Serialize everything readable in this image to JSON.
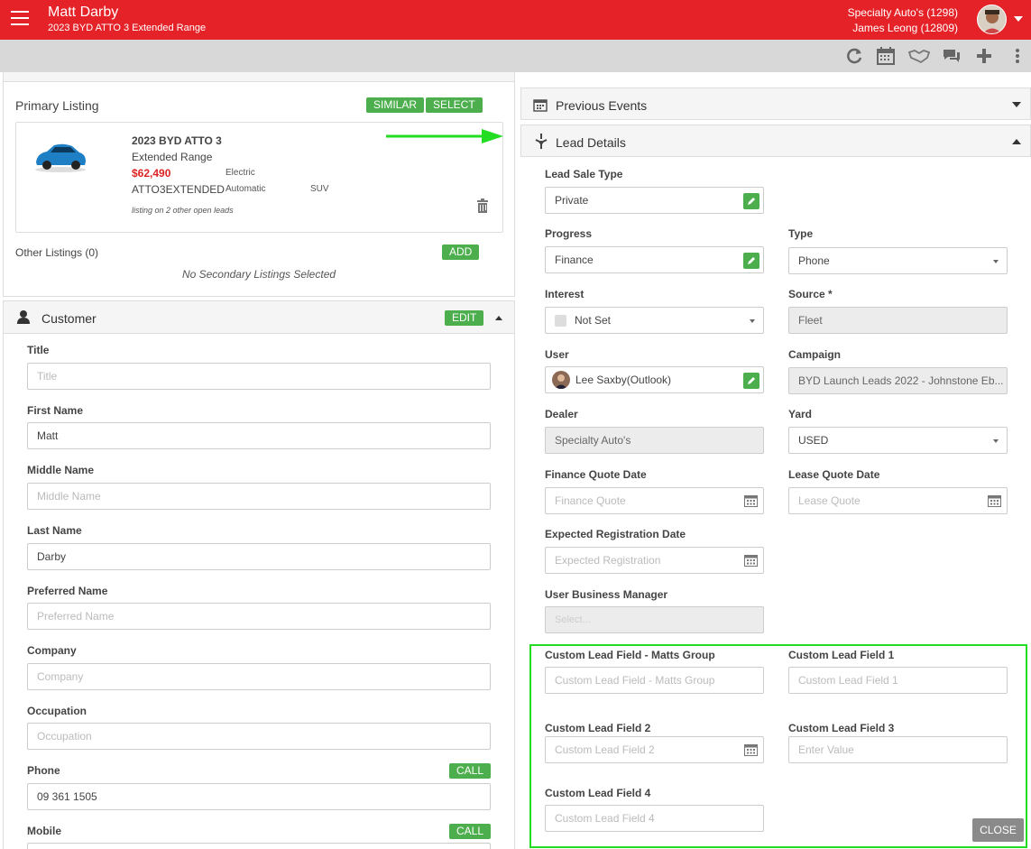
{
  "header": {
    "customer_name": "Matt Darby",
    "vehicle": "2023 BYD ATTO 3 Extended Range",
    "dealer": "Specialty Auto's (1298)",
    "user": "James Leong (12809)"
  },
  "toolbar": {
    "icons": [
      "refresh-icon",
      "calendar-icon",
      "handshake-icon",
      "chat-icon",
      "plus-icon",
      "more-icon"
    ]
  },
  "listing": {
    "title": "Primary Listing",
    "similar_label": "SIMILAR",
    "select_label": "SELECT",
    "vehicle_title": "2023 BYD ATTO 3",
    "variant": "Extended Range",
    "price": "$62,490",
    "fuel": "Electric",
    "code": "ATTO3EXTENDED",
    "transmission": "Automatic",
    "body": "SUV",
    "note": "listing on 2 other open leads",
    "other_title": "Other Listings (0)",
    "add_label": "ADD",
    "no_secondary": "No Secondary Listings Selected"
  },
  "customer": {
    "title": "Customer",
    "edit_label": "EDIT",
    "call_label": "CALL",
    "fields": {
      "title_label": "Title",
      "title_ph": "Title",
      "first_label": "First Name",
      "first_val": "Matt",
      "middle_label": "Middle Name",
      "middle_ph": "Middle Name",
      "last_label": "Last Name",
      "last_val": "Darby",
      "pref_label": "Preferred Name",
      "pref_ph": "Preferred Name",
      "company_label": "Company",
      "company_ph": "Company",
      "occupation_label": "Occupation",
      "occupation_ph": "Occupation",
      "phone_label": "Phone",
      "phone_val": "09 361 1505",
      "mobile_label": "Mobile"
    }
  },
  "right": {
    "previous_events": "Previous Events",
    "lead_details": "Lead Details",
    "lead_sale_type_label": "Lead Sale Type",
    "lead_sale_type": "Private",
    "progress_label": "Progress",
    "progress": "Finance",
    "type_label": "Type",
    "type": "Phone",
    "interest_label": "Interest",
    "interest": "Not Set",
    "source_label": "Source *",
    "source": "Fleet",
    "user_label": "User",
    "user": "Lee Saxby(Outlook)",
    "campaign_label": "Campaign",
    "campaign": "BYD Launch Leads 2022 - Johnstone Eb...",
    "dealer_label": "Dealer",
    "dealer": "Specialty Auto's",
    "yard_label": "Yard",
    "yard": "USED",
    "fqd_label": "Finance Quote Date",
    "fqd_ph": "Finance Quote",
    "lqd_label": "Lease Quote Date",
    "lqd_ph": "Lease Quote",
    "erd_label": "Expected Registration Date",
    "erd_ph": "Expected Registration",
    "ubm_label": "User Business Manager",
    "ubm_ph": "Select...",
    "clf_mg_label": "Custom Lead Field - Matts Group",
    "clf_mg_ph": "Custom Lead Field - Matts Group",
    "clf1_label": "Custom Lead Field 1",
    "clf1_ph": "Custom Lead Field 1",
    "clf2_label": "Custom Lead Field 2",
    "clf2_ph": "Custom Lead Field 2",
    "clf3_label": "Custom Lead Field 3",
    "clf3_ph": "Enter Value",
    "clf4_label": "Custom Lead Field 4",
    "clf4_ph": "Custom Lead Field 4",
    "close_label": "CLOSE"
  },
  "colors": {
    "brand_red": "#e52228",
    "green": "#4cae4c",
    "highlight": "#22dd22"
  }
}
